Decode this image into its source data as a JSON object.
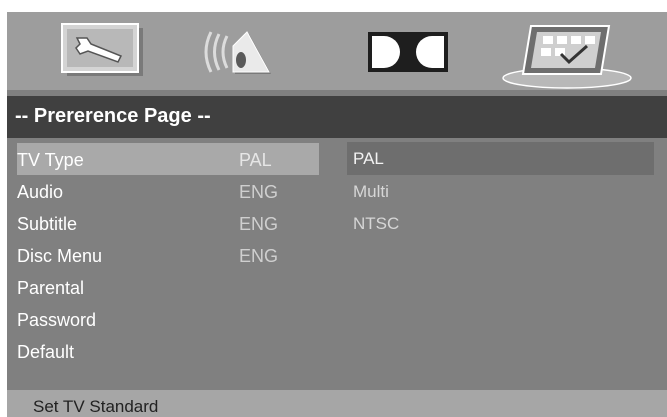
{
  "colors": {
    "screen": "#808080",
    "iconbar": "#9d9d9d",
    "titlebar": "#404040",
    "selected_row": "#a9a9a9",
    "selected_option": "#6e6e6e",
    "statusbar": "#a6a6a6"
  },
  "icons": [
    "wrench-setup-icon",
    "speaker-audio-icon",
    "dolby-icon",
    "preference-checkmark-icon"
  ],
  "title": "-- Prererence Page --",
  "menu": {
    "items": [
      {
        "label": "TV Type",
        "value": "PAL",
        "selected": true
      },
      {
        "label": "Audio",
        "value": "ENG"
      },
      {
        "label": "Subtitle",
        "value": "ENG"
      },
      {
        "label": "Disc Menu",
        "value": "ENG"
      },
      {
        "label": "Parental",
        "value": ""
      },
      {
        "label": "Password",
        "value": ""
      },
      {
        "label": "Default",
        "value": ""
      }
    ]
  },
  "options": [
    {
      "label": "PAL",
      "selected": true
    },
    {
      "label": "Multi"
    },
    {
      "label": "NTSC"
    }
  ],
  "status": "Set TV Standard"
}
